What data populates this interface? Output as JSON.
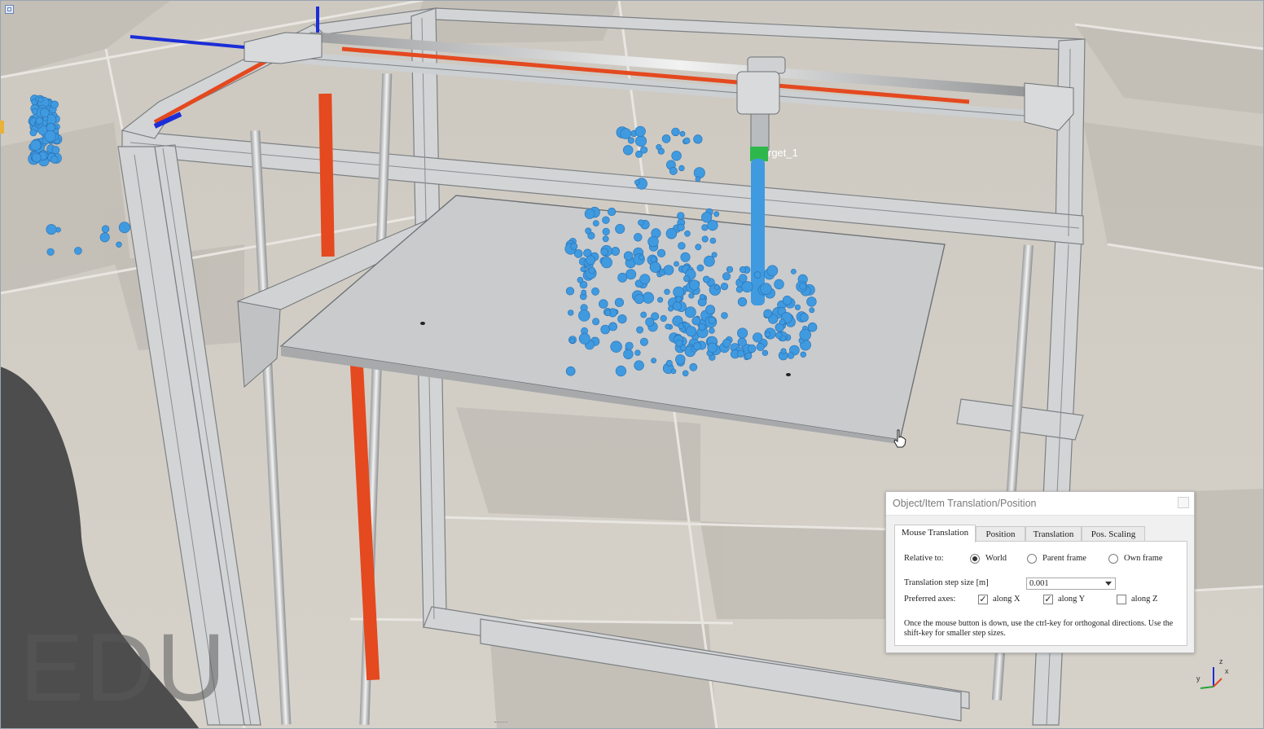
{
  "scene": {
    "dummy_label": "rget_1",
    "watermark": "EDU",
    "axis_gizmo": {
      "z": "z",
      "y": "y",
      "x": "x"
    },
    "colors": {
      "floor_light": "#d8d4cc",
      "floor_dark": "#bdb9b1",
      "frame": "#cfd1d3",
      "rod_orange": "#e4491f",
      "particle_blue": "#3f9ae0",
      "bed": "#c9cbcd",
      "axis_blue": "#1c2ed6"
    }
  },
  "dialog": {
    "title": "Object/Item Translation/Position",
    "tabs": [
      {
        "label": "Mouse Translation",
        "active": true
      },
      {
        "label": "Position",
        "active": false
      },
      {
        "label": "Translation",
        "active": false
      },
      {
        "label": "Pos. Scaling",
        "active": false
      }
    ],
    "relative_to_label": "Relative to:",
    "relative_options": [
      {
        "label": "World",
        "checked": true
      },
      {
        "label": "Parent frame",
        "checked": false
      },
      {
        "label": "Own frame",
        "checked": false
      }
    ],
    "step_size_label": "Translation step size [m]",
    "step_size_value": "0.001",
    "preferred_axes_label": "Preferred axes:",
    "axes": [
      {
        "label": "along X",
        "checked": true
      },
      {
        "label": "along Y",
        "checked": true
      },
      {
        "label": "along Z",
        "checked": false
      }
    ],
    "note": "Once the mouse button is down, use the ctrl-key for orthogonal directions. Use the shift-key for smaller step sizes."
  }
}
